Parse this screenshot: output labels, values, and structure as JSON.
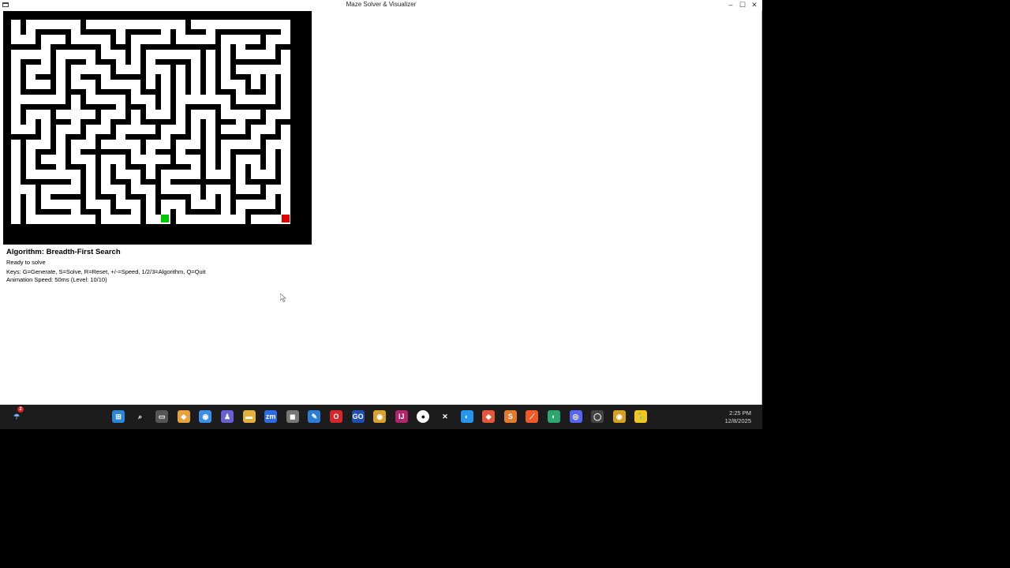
{
  "window": {
    "title": "Maze Solver & Visualizer"
  },
  "maze": {
    "wall_color": "#000000",
    "path_color": "#ffffff",
    "start_color": "#00c800",
    "end_color": "#e00000"
  },
  "info": {
    "algorithm": "Algorithm: Breadth-First Search",
    "status": "Ready to solve",
    "keys": "Keys: G=Generate, S=Solve, R=Reset, +/-=Speed, 1/2/3=Algorithm, Q=Quit",
    "speed": "Animation Speed: 50ms (Level: 10/10)"
  },
  "taskbar": {
    "weather_badge": "2",
    "icons": [
      "start-icon",
      "search-icon",
      "task-view-icon",
      "copilot-icon",
      "chrome-icon",
      "teams-icon",
      "file-explorer-icon",
      "zoom-icon",
      "camera-icon",
      "vscode-icon",
      "opera-icon",
      "goland-icon",
      "chrome-canary-icon",
      "intellij-icon",
      "openai-icon",
      "red-app-icon",
      "docker-icon",
      "git-icon",
      "sublime-icon",
      "app-orange-icon",
      "edge-dev-icon",
      "discord-icon",
      "obs-icon",
      "chrome-dev-icon",
      "python-icon"
    ],
    "zoom_label": "zm",
    "clock_time": "2:25 PM",
    "clock_date": "12/8/2025"
  }
}
